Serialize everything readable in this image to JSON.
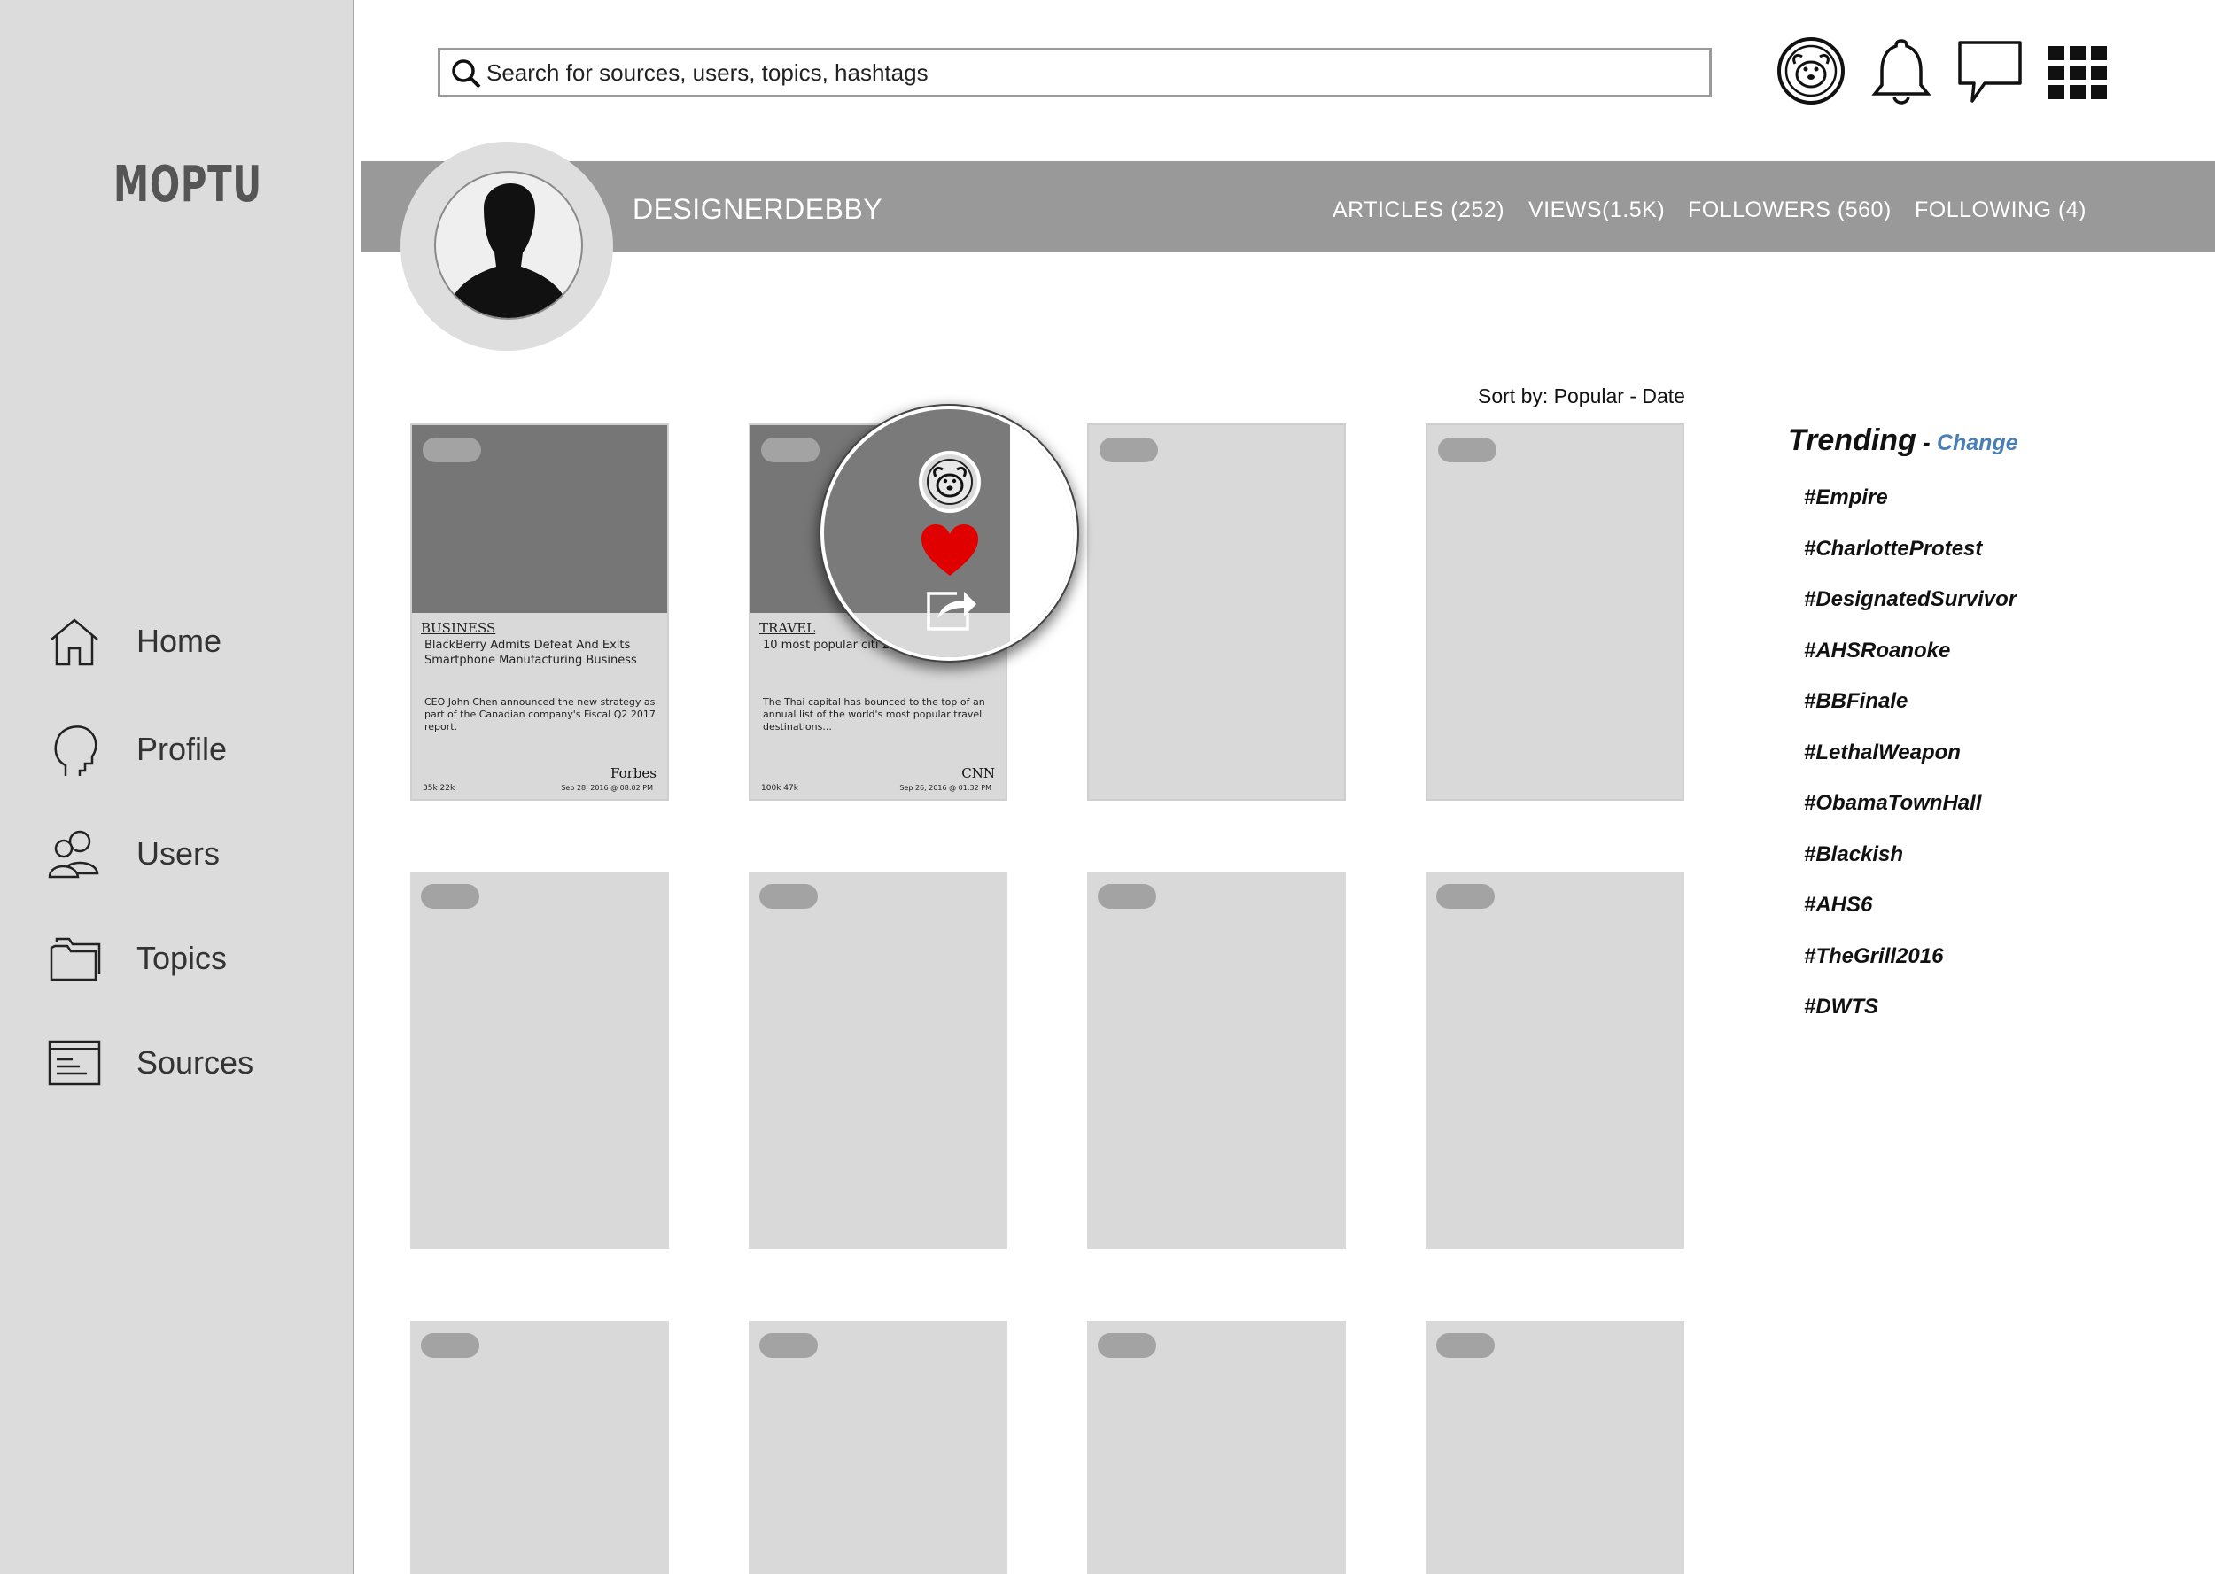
{
  "app": {
    "logo": "MOPTU"
  },
  "nav": {
    "items": [
      {
        "label": "Home",
        "icon": "home-icon"
      },
      {
        "label": "Profile",
        "icon": "head-profile-icon"
      },
      {
        "label": "Users",
        "icon": "users-icon"
      },
      {
        "label": "Topics",
        "icon": "folder-icon"
      },
      {
        "label": "Sources",
        "icon": "sources-list-icon"
      }
    ]
  },
  "search": {
    "placeholder": "Search for sources, users, topics, hashtags",
    "value": ""
  },
  "header_icons": [
    "dog-avatar-icon",
    "bell-icon",
    "chat-bubble-icon",
    "apps-grid-icon"
  ],
  "profile": {
    "username": "DESIGNERDEBBY",
    "stats": {
      "articles": "ARTICLES (252)",
      "views": "VIEWS(1.5K)",
      "followers": "FOLLOWERS (560)",
      "following": "FOLLOWING (4)"
    }
  },
  "sort": {
    "prefix": "Sort by: ",
    "popular": "Popular",
    "separator": " - ",
    "date": "Date"
  },
  "articles": [
    {
      "category": "BUSINESS",
      "headline": "BlackBerry Admits Defeat And Exits Smartphone Manufacturing Business",
      "summary": "CEO John Chen announced the new strategy as part of the Canadian company's Fiscal Q2 2017 report.",
      "source": "Forbes",
      "counts": "35k   22k",
      "date": "Sep 28, 2016 @ 08:02 PM"
    },
    {
      "category": "TRAVEL",
      "headline": "10 most popular citi 2016",
      "summary": "The Thai capital has bounced to the top of an annual list of the world's most popular travel destinations...",
      "source": "CNN",
      "counts": "100k   47k",
      "date": "Sep 26, 2016 @ 01:32 PM"
    }
  ],
  "card_actions": [
    "dog-avatar-icon",
    "heart-icon",
    "share-icon"
  ],
  "colors": {
    "heart": "#e00000",
    "change_link": "#4a7fb5",
    "profile_bar": "#999999"
  },
  "trending": {
    "title": "Trending",
    "separator": " - ",
    "change_label": "Change",
    "tags": [
      "#Empire",
      "#CharlotteProtest",
      "#DesignatedSurvivor",
      "#AHSRoanoke",
      "#BBFinale",
      "#LethalWeapon",
      "#ObamaTownHall",
      "#Blackish",
      "#AHS6",
      "#TheGrill2016",
      "#DWTS"
    ]
  }
}
